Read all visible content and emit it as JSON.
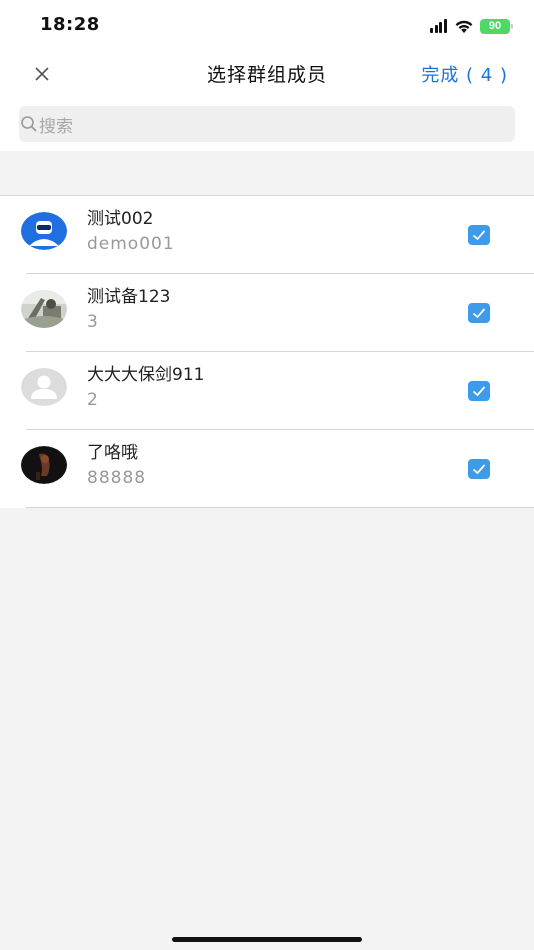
{
  "status_bar": {
    "time": "18:28",
    "battery": "90"
  },
  "nav": {
    "title": "选择群组成员",
    "done_label": "完成 ( 4 )"
  },
  "search": {
    "placeholder": "搜索"
  },
  "members": [
    {
      "name": "测试002",
      "sub": "demo001",
      "checked": true,
      "avatar": "blue-person-avatar"
    },
    {
      "name": "测试备123",
      "sub": "3",
      "checked": true,
      "avatar": "photo-avatar"
    },
    {
      "name": "大大大保剑911",
      "sub": "2",
      "checked": true,
      "avatar": "default-person-avatar"
    },
    {
      "name": "了咯哦",
      "sub": "88888",
      "checked": true,
      "avatar": "dark-photo-avatar"
    }
  ],
  "colors": {
    "accent": "#1a73d9",
    "checkbox": "#3d9be9",
    "battery": "#4cd964"
  }
}
